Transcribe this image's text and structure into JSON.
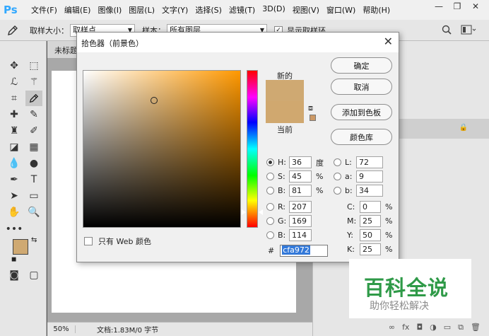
{
  "app": {
    "logo": "Ps"
  },
  "menu": [
    "文件(F)",
    "编辑(E)",
    "图像(I)",
    "图层(L)",
    "文字(Y)",
    "选择(S)",
    "滤镜(T)",
    "3D(D)",
    "视图(V)",
    "窗口(W)",
    "帮助(H)"
  ],
  "window_controls": {
    "minimize": "—",
    "restore": "❐",
    "close": "✕"
  },
  "options_bar": {
    "sample_size_label": "取样大小：",
    "sample_size_value": "取样点",
    "sample_label": "样本：",
    "sample_value": "所有图层",
    "show_ring_label": "显示取样环",
    "show_ring_checked": true
  },
  "document": {
    "tab_title": "未标题"
  },
  "status": {
    "zoom": "50%",
    "doc_info": "文档:1.83M/0 字节"
  },
  "dialog": {
    "title": "拾色器（前景色）",
    "close": "✕",
    "new_label": "新的",
    "current_label": "当前",
    "web_only_label": "只有 Web 颜色",
    "buttons": {
      "ok": "确定",
      "cancel": "取消",
      "add_swatch": "添加到色板",
      "color_libraries": "颜色库"
    },
    "hsb": {
      "H": "36",
      "S": "45",
      "B": "81",
      "H_unit": "度",
      "S_unit": "%",
      "B_unit": "%"
    },
    "rgb": {
      "R": "207",
      "G": "169",
      "B": "114"
    },
    "lab": {
      "L": "72",
      "a": "9",
      "b": "34"
    },
    "cmyk": {
      "C": "0",
      "M": "25",
      "Y": "50",
      "K": "25",
      "unit": "%"
    },
    "hex_label": "#",
    "hex": "cfa972",
    "selected_mode": "H",
    "new_color": "#cfa972",
    "current_color": "#d0a86f",
    "websafe_color": "#cc9966",
    "hue_base_color": "#ff9800",
    "field_saturation_fraction": 0.45,
    "field_brightness_fraction": 0.81,
    "hue_fraction_from_top": 0.9
  },
  "toolbar": {
    "foreground_color": "#cfa972",
    "background_color": "#ffffff"
  },
  "watermark": {
    "title": "百科全说",
    "subtitle": "助你轻松解决"
  }
}
